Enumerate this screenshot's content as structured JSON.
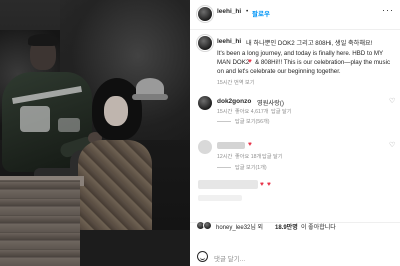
{
  "post": {
    "author": "leehi_hi",
    "follow_label": "팔로우",
    "more_icon": "more-dots-icon",
    "caption_korean": "내 하나뿐인 DOK2 그리고 808Hi, 생일 축하해요!",
    "caption_en_1": "It's been a long journey, and today is finally here. HBD to MY",
    "caption_en_2": "MAN DOK2",
    "caption_en_2b": "& 808Hi!!! This is our celebration—play the music",
    "caption_en_3": "on and let's celebrate our beginning together.",
    "caption_time": "15시간",
    "caption_translate": "번역 보기"
  },
  "comments": [
    {
      "user": "dok2gonzo",
      "text": "영원사랑()",
      "time": "15시간",
      "likes": "좋아요 4,617개",
      "reply": "답글 달기",
      "view_replies": "답글 보기(56개)"
    },
    {
      "user": "",
      "text": "",
      "time": "12시간",
      "likes": "좋아요 18개",
      "reply": "답글 달기",
      "view_replies": "답글 보기(1개)"
    }
  ],
  "likes_line": {
    "prefix": "honey_lee32님 외",
    "count": "18.9만명",
    "suffix": "이 좋아합니다"
  },
  "actions": {
    "like_icon": "heart-icon",
    "comment_icon": "comment-icon",
    "share_icon": "share-icon",
    "save_icon": "bookmark-icon"
  },
  "comment_input": {
    "placeholder": "댓글 달기..."
  },
  "colors": {
    "link_blue": "#0095f6",
    "heart_red": "#e8344a",
    "meta_gray": "#8e8e8e"
  }
}
